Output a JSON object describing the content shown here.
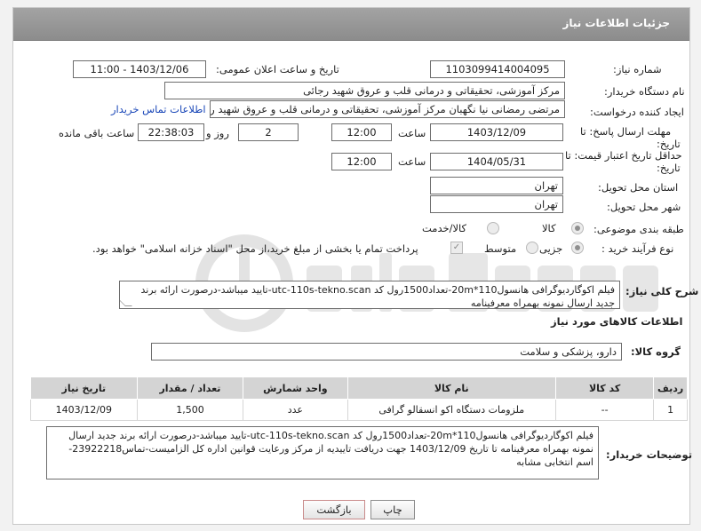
{
  "panel": {
    "title": "جزئیات اطلاعات نیاز"
  },
  "fields": {
    "need_number_label": "شماره نیاز:",
    "need_number": "1103099414004095",
    "announce_label": "تاریخ و ساعت اعلان عمومی:",
    "announce_value": "1403/12/06 - 11:00",
    "buyer_org_label": "نام دستگاه خریدار:",
    "buyer_org": "مرکز آموزشی، تحقیقاتی و درمانی قلب و عروق شهید رجائی",
    "requester_label": "ایجاد کننده درخواست:",
    "requester": "مرتضی رمضانی نیا نگهبان مرکز آموزشی، تحقیقاتی و درمانی قلب و عروق شهید رجائی",
    "contact_link": "اطلاعات تماس خریدار",
    "deadline_label_1": "مهلت ارسال پاسخ: تا",
    "deadline_label_2": "تاریخ:",
    "deadline_date": "1403/12/09",
    "time_word": "ساعت",
    "deadline_time": "12:00",
    "days_value": "2",
    "days_word": "روز و",
    "remaining_time": "22:38:03",
    "remaining_word": "ساعت باقی مانده",
    "validity_label_1": "حداقل تاریخ اعتبار قیمت: تا",
    "validity_label_2": "تاریخ:",
    "validity_date": "1404/05/31",
    "validity_time": "12:00",
    "province_label": "استان محل تحویل:",
    "province": "تهران",
    "city_label": "شهر محل تحویل:",
    "city": "تهران",
    "category_label": "طبقه بندی موضوعی:",
    "category_options": [
      "کالا",
      "کالا/خدمت"
    ],
    "process_label": "نوع فرآیند خرید :",
    "process_options": [
      "جزیی",
      "متوسط"
    ],
    "payment_note": "پرداخت تمام یا بخشی از مبلغ خرید،از محل \"اسناد خزانه اسلامی\" خواهد بود."
  },
  "summary": {
    "label": "شرح کلی نیاز:",
    "text": "فیلم اکوگاردیوگرافی هانسول110*20m-تعداد1500رول کد utc-110s-tekno.scan-تایید میباشد-درصورت ارائه برند جدید ارسال نمونه بهمراه معرفینامه"
  },
  "goods_section": {
    "title": "اطلاعات کالاهای مورد نیاز",
    "group_label": "گروه کالا:",
    "group_value": "دارو، پزشکی و سلامت"
  },
  "table": {
    "headers": [
      "ردیف",
      "کد کالا",
      "نام کالا",
      "واحد شمارش",
      "تعداد / مقدار",
      "تاریخ نیاز"
    ],
    "rows": [
      {
        "index": "1",
        "code": "--",
        "name": "ملزومات دستگاه اکو انسقالو گرافی",
        "unit": "عدد",
        "qty": "1,500",
        "date": "1403/12/09"
      }
    ]
  },
  "buyer_notes": {
    "label": "توضیحات خریدار:",
    "text": "فیلم اکوگاردیوگرافی هانسول110*20m-تعداد1500رول کد utc-110s-tekno.scan-تایید میباشد-درصورت ارائه برند جدید ارسال نمونه بهمراه معرفینامه تا تاریخ 1403/12/09 جهت دریافت تاییدیه از مرکز ورعایت قوانین اداره کل الزامیست-تماس23922218-اسم انتخابی مشابه"
  },
  "buttons": {
    "print": "چاپ",
    "back": "بازگشت"
  },
  "colors": {
    "header": "#969696",
    "link": "#1a47b8",
    "watermark": "#e2e2e2"
  }
}
